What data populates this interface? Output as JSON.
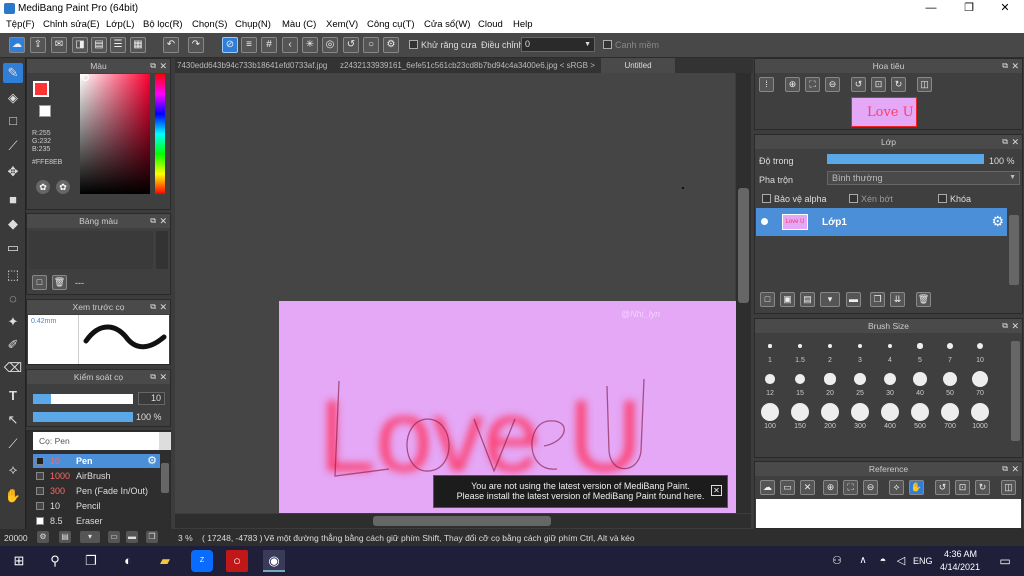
{
  "window": {
    "title": "MediBang Paint Pro (64bit)",
    "min": "—",
    "max": "❐",
    "close": "✕"
  },
  "menu": [
    "Tệp(F)",
    "Chỉnh sửa(E)",
    "Lớp(L)",
    "Bộ lọc(R)",
    "Chọn(S)",
    "Chụp(N)",
    "Màu (C)",
    "Xem(V)",
    "Công cụ(T)",
    "Cửa sổ(W)",
    "Cloud",
    "Help"
  ],
  "toolbar": {
    "antialias_label": "Khử răng cưa",
    "correction_label": "Điều chỉnh",
    "correction_value": "0",
    "canh_mem_label": "Canh mềm"
  },
  "color_panel": {
    "title": "Màu",
    "r": "R:255",
    "g": "G:232",
    "b": "B:235",
    "hex": "#FFE8EB",
    "primary": "#ff3333",
    "secondary": "#ffffff"
  },
  "palette_panel": {
    "title": "Bảng màu",
    "dash": "---"
  },
  "brush_preview": {
    "title": "Xem trước cọ",
    "size": "0.42mm"
  },
  "brush_control": {
    "title": "Kiểm soát cọ",
    "size_value": "10",
    "opacity_value": "100 %"
  },
  "brush_list": {
    "header": "Cọ: Pen",
    "items": [
      {
        "size": "10",
        "name": "Pen",
        "selected": true
      },
      {
        "size": "1000",
        "name": "AirBrush",
        "selected": false
      },
      {
        "size": "300",
        "name": "Pen (Fade In/Out)",
        "selected": false
      },
      {
        "size": "10",
        "name": "Pencil",
        "selected": false
      },
      {
        "size": "8.5",
        "name": "Eraser",
        "selected": false
      }
    ]
  },
  "tabs": [
    "7430edd643b94c733b18641efd0733af.jpg",
    "z2432133939161_6efe51c561cb23cd8b7bd94c4a3400e6.jpg < sRGB >",
    "Untitled"
  ],
  "canvas": {
    "text": "Love U",
    "watermark": "@Nhi_lyn"
  },
  "navigator": {
    "title": "Hoa tiêu",
    "thumb_text": "Love U"
  },
  "layer_panel": {
    "title": "Lớp",
    "opacity_label": "Độ trong",
    "opacity_value": "100 %",
    "blend_label": "Pha trộn",
    "blend_value": "Bình thường",
    "protect_alpha": "Bảo vệ alpha",
    "clipping": "Xén bớt",
    "lock": "Khóa",
    "layers": [
      {
        "name": "Lớp1",
        "thumb": "Love U"
      }
    ]
  },
  "brush_size_panel": {
    "title": "Brush Size",
    "sizes": [
      "1",
      "1.5",
      "2",
      "3",
      "4",
      "5",
      "7",
      "10",
      "12",
      "15",
      "20",
      "25",
      "30",
      "40",
      "50",
      "70",
      "100",
      "150",
      "200",
      "300",
      "400",
      "500",
      "700",
      "1000"
    ]
  },
  "reference_panel": {
    "title": "Reference"
  },
  "notice": {
    "line1": "You are not using the latest version of MediBang Paint.",
    "line2": "Please install the latest version of MediBang Paint found here."
  },
  "status": {
    "zoom_left": "20000",
    "zoom": "3 %",
    "coords": "( 17248, -4783 )",
    "hint": "Vẽ một đường thẳng bằng cách giữ phím Shift, Thay đổi cỡ cọ bằng cách giữ phím Ctrl, Alt và kéo"
  },
  "taskbar": {
    "lang": "ENG",
    "time": "4:36 AM",
    "date": "4/14/2021"
  }
}
